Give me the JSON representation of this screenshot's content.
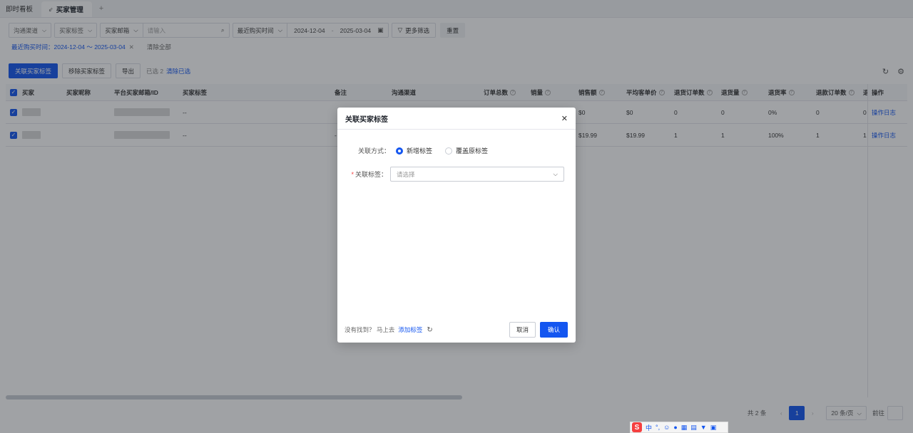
{
  "tabs": [
    {
      "label": "即时看板"
    },
    {
      "label": "买家管理",
      "pin": "⇙"
    }
  ],
  "tab_add": "+",
  "filters": {
    "channel": "沟通渠道",
    "buyer_tag": "买家标签",
    "search_field": "买家邮箱",
    "search_placeholder": "请输入",
    "date_field": "最近购买时间",
    "date_start": "2024-12-04",
    "date_sep": "-",
    "date_end": "2025-03-04",
    "more_filter": "更多筛选",
    "reset": "重置",
    "active_chip": "最近购买时间：2024-12-04 ～ 2025-03-04",
    "clear_all": "清除全部"
  },
  "toolbar": {
    "assoc_tag": "关联买家标签",
    "remove_tag": "移除买家标签",
    "export": "导出",
    "selected": "已选 2",
    "clear_selected": "清除已选"
  },
  "table": {
    "headers": [
      "买家",
      "买家昵称",
      "平台买家邮箱/ID",
      "买家标签",
      "备注",
      "沟通渠道",
      "订单总数",
      "销量",
      "销售额",
      "平均客单价",
      "退货订单数",
      "退货量",
      "退货率",
      "退款订单数",
      "退",
      "操作"
    ],
    "rows": [
      {
        "tag": "--",
        "sales": "$0",
        "avg": "$0",
        "ret_orders": "0",
        "ret_qty": "0",
        "ret_rate": "0%",
        "refund_orders": "0",
        "tail": "0",
        "op": "操作日志"
      },
      {
        "tag": "--",
        "remark": "-",
        "sales": "$19.99",
        "avg": "$19.99",
        "ret_orders": "1",
        "ret_qty": "1",
        "ret_rate": "100%",
        "refund_orders": "1",
        "tail": "1",
        "op": "操作日志"
      }
    ]
  },
  "pager": {
    "total": "共 2 条",
    "prev": "‹",
    "current": "1",
    "next": "›",
    "size": "20 条/页",
    "goto": "前往"
  },
  "modal": {
    "title": "关联买家标签",
    "mode_label": "关联方式：",
    "option_new": "新增标签",
    "option_overwrite": "覆盖原标签",
    "tag_label": "关联标签：",
    "tag_placeholder": "请选择",
    "hint": "没有找到？ 马上去",
    "add_tag_link": "添加标签",
    "cancel": "取消",
    "confirm": "确认"
  },
  "ime": {
    "s": "S",
    "zh": "中"
  }
}
